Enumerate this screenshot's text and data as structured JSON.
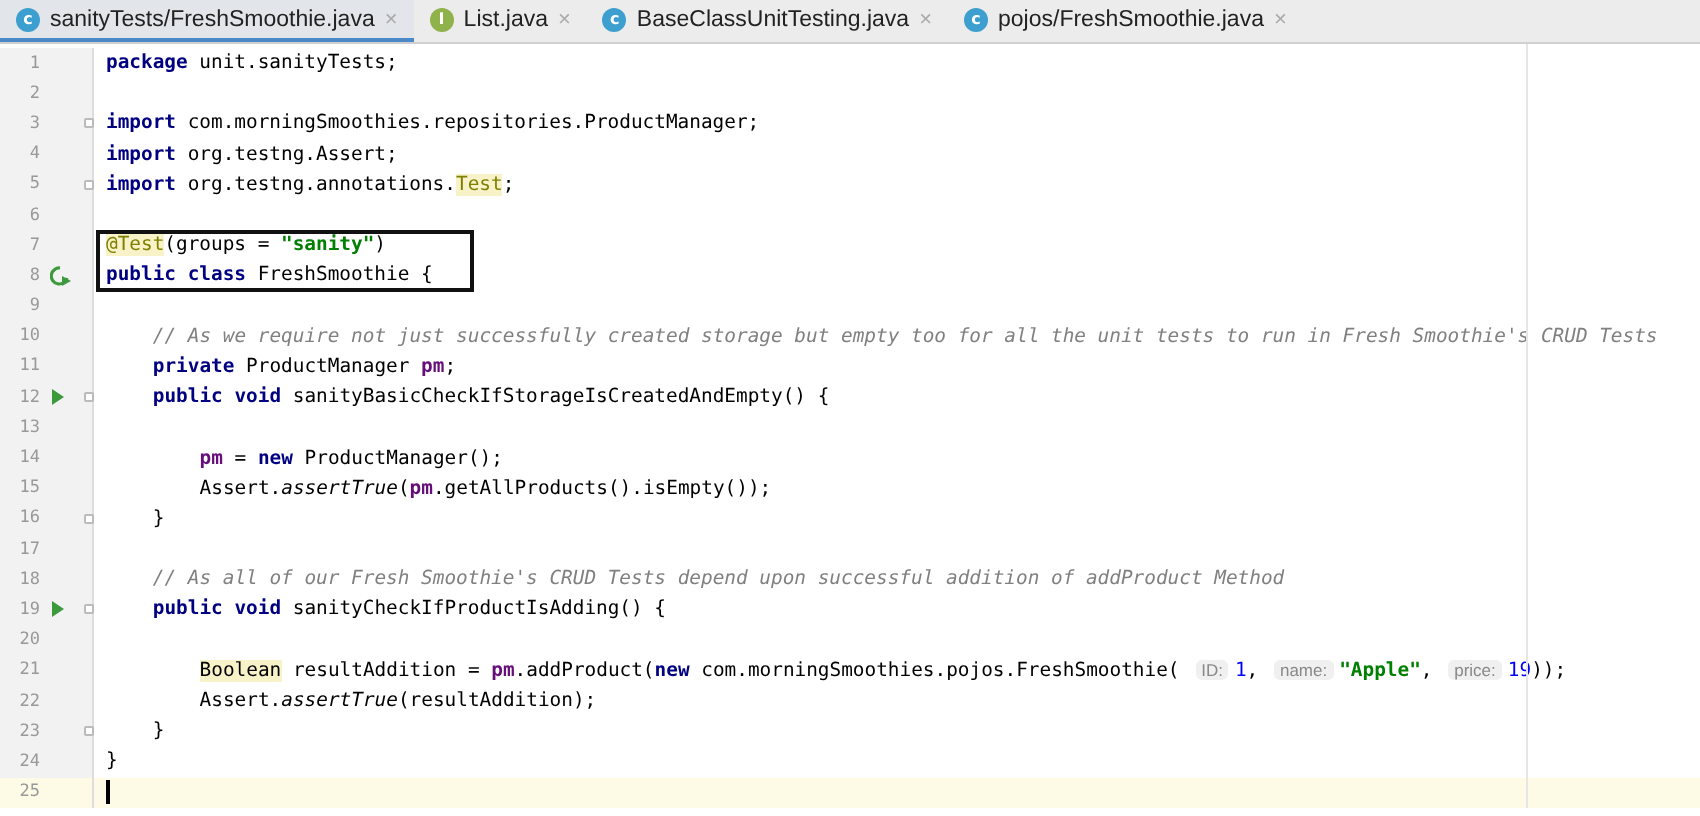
{
  "tabs": [
    {
      "label": "sanityTests/FreshSmoothie.java",
      "icon_text": "c",
      "kind": "class",
      "close": "×",
      "selected": true
    },
    {
      "label": "List.java",
      "icon_text": "I",
      "kind": "interface",
      "close": "×",
      "selected": false
    },
    {
      "label": "BaseClassUnitTesting.java",
      "icon_text": "c",
      "kind": "class",
      "close": "×",
      "selected": false
    },
    {
      "label": "pojos/FreshSmoothie.java",
      "icon_text": "c",
      "kind": "class",
      "close": "×",
      "selected": false
    }
  ],
  "lines": [
    {
      "number": "1",
      "tokens": [
        {
          "kind": "kw",
          "text": "package"
        },
        {
          "kind": "plain",
          "text": " unit.sanityTests;"
        }
      ]
    },
    {
      "number": "2"
    },
    {
      "number": "3",
      "fold": true,
      "tokens": [
        {
          "kind": "kw",
          "text": "import"
        },
        {
          "kind": "plain",
          "text": " com.morningSmoothies.repositories.ProductManager;"
        }
      ]
    },
    {
      "number": "4",
      "tokens": [
        {
          "kind": "kw",
          "text": "import"
        },
        {
          "kind": "plain",
          "text": " org.testng.Assert;"
        }
      ]
    },
    {
      "number": "5",
      "fold": true,
      "tokens": [
        {
          "kind": "kw",
          "text": "import"
        },
        {
          "kind": "plain",
          "text": " org.testng.annotations."
        },
        {
          "kind": "annotation",
          "text": "Test"
        },
        {
          "kind": "plain",
          "text": ";"
        }
      ]
    },
    {
      "number": "6"
    },
    {
      "number": "7",
      "boxed": true,
      "tokens": [
        {
          "kind": "annotation",
          "text": "@Test"
        },
        {
          "kind": "plain",
          "text": "(groups = "
        },
        {
          "kind": "string",
          "text": "\"sanity\""
        },
        {
          "kind": "plain",
          "text": ")"
        }
      ]
    },
    {
      "number": "8",
      "boxed": true,
      "rerun_icon": true,
      "tokens": [
        {
          "kind": "kw",
          "text": "public class"
        },
        {
          "kind": "plain",
          "text": " FreshSmoothie {"
        }
      ],
      "children": [
        {
          "number": "9"
        },
        {
          "number": "10",
          "tokens": [
            {
              "kind": "comment",
              "text": "// As we require not just successfully created storage but empty too for all the unit tests to run in Fresh Smoothie's CRUD Tests"
            }
          ]
        },
        {
          "number": "11",
          "tokens": [
            {
              "kind": "kw",
              "text": "private"
            },
            {
              "kind": "plain",
              "text": " ProductManager "
            },
            {
              "kind": "field",
              "text": "pm"
            },
            {
              "kind": "plain",
              "text": ";"
            }
          ]
        },
        {
          "number": "12",
          "run_icon": true,
          "fold": true,
          "tokens": [
            {
              "kind": "kw",
              "text": "public void"
            },
            {
              "kind": "plain",
              "text": " sanityBasicCheckIfStorageIsCreatedAndEmpty() {"
            }
          ],
          "children": [
            {
              "number": "13"
            },
            {
              "number": "14",
              "tokens": [
                {
                  "kind": "field",
                  "text": "pm"
                },
                {
                  "kind": "plain",
                  "text": " = "
                },
                {
                  "kind": "kw",
                  "text": "new"
                },
                {
                  "kind": "plain",
                  "text": " ProductManager();"
                }
              ]
            },
            {
              "number": "15",
              "tokens": [
                {
                  "kind": "plain",
                  "text": "Assert."
                },
                {
                  "kind": "static",
                  "text": "assertTrue"
                },
                {
                  "kind": "plain",
                  "text": "("
                },
                {
                  "kind": "field",
                  "text": "pm"
                },
                {
                  "kind": "plain",
                  "text": ".getAllProducts().isEmpty());"
                }
              ]
            }
          ]
        },
        {
          "number": "16",
          "fold": true,
          "tokens": [
            {
              "kind": "plain",
              "text": "}"
            }
          ]
        },
        {
          "number": "17"
        },
        {
          "number": "18",
          "tokens": [
            {
              "kind": "comment",
              "text": "// As all of our Fresh Smoothie's CRUD Tests depend upon successful addition of addProduct Method"
            }
          ]
        },
        {
          "number": "19",
          "run_icon": true,
          "fold": true,
          "tokens": [
            {
              "kind": "kw",
              "text": "public void"
            },
            {
              "kind": "plain",
              "text": " sanityCheckIfProductIsAdding() {"
            }
          ],
          "children": [
            {
              "number": "20"
            },
            {
              "number": "21",
              "tokens": [
                {
                  "kind": "marked",
                  "text": "Boolean"
                },
                {
                  "kind": "plain",
                  "text": " resultAddition = "
                },
                {
                  "kind": "field",
                  "text": "pm"
                },
                {
                  "kind": "plain",
                  "text": ".addProduct("
                },
                {
                  "kind": "kw",
                  "text": "new"
                },
                {
                  "kind": "plain",
                  "text": " com.morningSmoothies.pojos.FreshSmoothie( "
                },
                {
                  "kind": "hint",
                  "text": "ID:"
                },
                {
                  "kind": "number",
                  "text": "1"
                },
                {
                  "kind": "plain",
                  "text": ", "
                },
                {
                  "kind": "hint",
                  "text": "name:"
                },
                {
                  "kind": "string",
                  "text": "\"Apple\""
                },
                {
                  "kind": "plain",
                  "text": ", "
                },
                {
                  "kind": "hint",
                  "text": "price:"
                },
                {
                  "kind": "number",
                  "text": "19"
                },
                {
                  "kind": "plain",
                  "text": "));"
                }
              ]
            },
            {
              "number": "22",
              "tokens": [
                {
                  "kind": "plain",
                  "text": "Assert."
                },
                {
                  "kind": "static",
                  "text": "assertTrue"
                },
                {
                  "kind": "plain",
                  "text": "(resultAddition);"
                }
              ]
            }
          ]
        },
        {
          "number": "23",
          "fold": true,
          "tokens": [
            {
              "kind": "plain",
              "text": "}"
            }
          ]
        }
      ]
    },
    {
      "number": "24",
      "tokens": [
        {
          "kind": "plain",
          "text": "}"
        }
      ]
    },
    {
      "number": "25",
      "current": true
    }
  ]
}
